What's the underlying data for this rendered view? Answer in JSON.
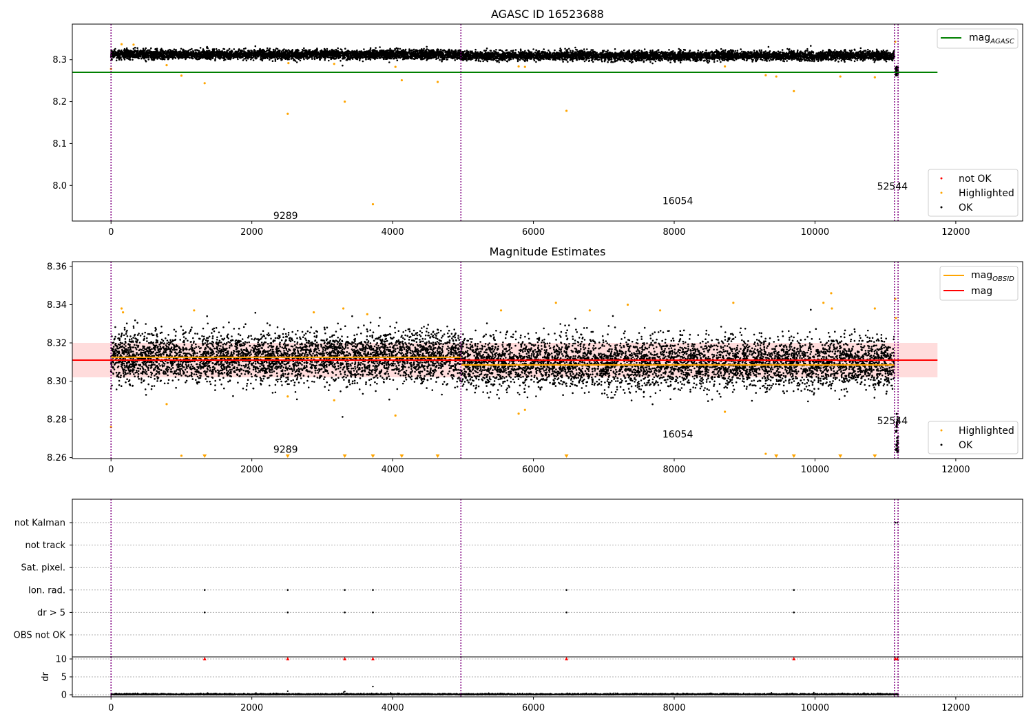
{
  "chart_data": [
    {
      "type": "scatter",
      "title": "AGASC ID 16523688",
      "xlim": [
        -550,
        12950
      ],
      "ylim": [
        7.915,
        8.385
      ],
      "xticks": [
        0,
        2000,
        4000,
        6000,
        8000,
        10000,
        12000
      ],
      "yticks": [
        8.0,
        8.1,
        8.2,
        8.3
      ],
      "ytick_labels": [
        "8.0",
        "8.1",
        "8.2",
        "8.3"
      ],
      "band": {
        "mean": 8.311,
        "std": 0.005
      },
      "series": [
        {
          "name": "not OK",
          "color": "#ff0000",
          "values": []
        },
        {
          "name": "Highlighted",
          "color": "#ffa500",
          "points": [
            [
              0,
              8.278
            ],
            [
              150,
              8.337
            ],
            [
              320,
              8.336
            ],
            [
              1000,
              8.262
            ],
            [
              1330,
              8.244
            ],
            [
              2510,
              8.171
            ],
            [
              3320,
              8.2
            ],
            [
              3720,
              7.955
            ],
            [
              4040,
              8.283
            ],
            [
              4130,
              8.251
            ],
            [
              4640,
              8.247
            ],
            [
              6470,
              8.178
            ],
            [
              9300,
              8.263
            ],
            [
              9450,
              8.26
            ],
            [
              9700,
              8.225
            ],
            [
              10360,
              8.26
            ],
            [
              10850,
              8.258
            ],
            [
              11140,
              8.343
            ],
            [
              790,
              8.287
            ],
            [
              3170,
              8.29
            ],
            [
              5790,
              8.284
            ],
            [
              5880,
              8.283
            ],
            [
              8720,
              8.284
            ],
            [
              2520,
              8.292
            ]
          ]
        },
        {
          "name": "OK",
          "color": "#000000",
          "trend_center": 8.311,
          "trend_spread": 0.007
        }
      ],
      "lines": [
        {
          "name": "mag_AGASC",
          "color": "#008000",
          "y": 8.27,
          "x_range": [
            -550,
            11740
          ]
        }
      ],
      "vlines": [
        0,
        4970,
        11130,
        11180
      ],
      "annotations": [
        {
          "text": "9289",
          "x": 2480,
          "y": 7.92
        },
        {
          "text": "16054",
          "x": 8050,
          "y": 7.955
        },
        {
          "text": "52544",
          "x": 11100,
          "y": 7.99
        }
      ],
      "legend_location": "lower right",
      "legend_top_right": "mag_AGASC"
    },
    {
      "type": "scatter",
      "title": "Magnitude Estimates",
      "xlim": [
        -550,
        12950
      ],
      "ylim": [
        8.2595,
        8.3625
      ],
      "xticks": [
        0,
        2000,
        4000,
        6000,
        8000,
        10000,
        12000
      ],
      "yticks": [
        8.26,
        8.28,
        8.3,
        8.32,
        8.34,
        8.36
      ],
      "ytick_labels": [
        "8.26",
        "8.28",
        "8.30",
        "8.32",
        "8.34",
        "8.36"
      ],
      "band": {
        "ymin": 8.302,
        "ymax": 8.32,
        "x_range": [
          -550,
          11740
        ],
        "color": "#ffc0c0"
      },
      "series": [
        {
          "name": "Highlighted",
          "color": "#ffa500",
          "points": [
            [
              0,
              8.276
            ],
            [
              150,
              8.338
            ],
            [
              170,
              8.336
            ],
            [
              1000,
              8.261
            ],
            [
              790,
              8.288
            ],
            [
              2510,
              8.292
            ],
            [
              3170,
              8.29
            ],
            [
              3300,
              8.338
            ],
            [
              4040,
              8.282
            ],
            [
              5790,
              8.283
            ],
            [
              5880,
              8.285
            ],
            [
              6320,
              8.341
            ],
            [
              6800,
              8.337
            ],
            [
              7340,
              8.34
            ],
            [
              7800,
              8.337
            ],
            [
              8720,
              8.284
            ],
            [
              8840,
              8.341
            ],
            [
              9300,
              8.262
            ],
            [
              10120,
              8.341
            ],
            [
              10230,
              8.346
            ],
            [
              10240,
              8.338
            ],
            [
              10850,
              8.338
            ],
            [
              11140,
              8.343
            ],
            [
              11150,
              8.333
            ],
            [
              5540,
              8.337
            ],
            [
              2880,
              8.336
            ],
            [
              3640,
              8.335
            ],
            [
              1180,
              8.337
            ]
          ]
        },
        {
          "name": "OK",
          "color": "#000000",
          "trend_center": 8.311,
          "trend_spread": 0.007
        }
      ],
      "floor_markers": [
        1330,
        2510,
        3320,
        3720,
        4130,
        4640,
        6470,
        9450,
        9700,
        10360,
        10850
      ],
      "lines": [
        {
          "name": "mag_OBSID",
          "color": "#ffa500",
          "segments": [
            [
              0,
              4970,
              8.3125
            ],
            [
              4970,
              11130,
              8.3085
            ]
          ]
        },
        {
          "name": "mag",
          "color": "#ff0000",
          "y": 8.311,
          "x_range": [
            -550,
            11740
          ]
        }
      ],
      "vlines": [
        0,
        4970,
        11130,
        11180
      ],
      "annotations": [
        {
          "text": "9289",
          "x": 2480,
          "y": 8.2625
        },
        {
          "text": "16054",
          "x": 8050,
          "y": 8.2705
        },
        {
          "text": "52544",
          "x": 11100,
          "y": 8.2775
        }
      ],
      "legend_top_right": [
        "mag_OBSID",
        "mag"
      ],
      "legend_bottom_right": [
        "Highlighted",
        "OK"
      ]
    },
    {
      "type": "scatter",
      "title": "",
      "xlim": [
        -550,
        12950
      ],
      "categories": [
        "not Kalman",
        "not track",
        "Sat. pixel.",
        "Ion. rad.",
        "dr > 5",
        "OBS not OK"
      ],
      "flags": {
        "not Kalman": [
          11140,
          11170
        ],
        "not track": [],
        "Sat. pixel.": [],
        "Ion. rad.": [
          1330,
          2510,
          3320,
          3720,
          6470,
          9700
        ],
        "dr > 5": [
          1330,
          2510,
          3320,
          3720,
          6470,
          9700
        ],
        "OBS not OK": []
      },
      "vlines": [
        0,
        4970,
        11130,
        11180
      ]
    },
    {
      "type": "scatter",
      "title": "",
      "xlim": [
        -550,
        12950
      ],
      "ylim": [
        -0.5,
        10.5
      ],
      "ylabel": "dr",
      "yticks": [
        0,
        5,
        10
      ],
      "ytick_labels": [
        "0",
        "5",
        "10"
      ],
      "xticks": [
        0,
        2000,
        4000,
        6000,
        8000,
        10000,
        12000
      ],
      "overflow_markers": [
        1330,
        2510,
        3320,
        3720,
        6470,
        9700,
        11140,
        11170
      ],
      "outliers": [
        [
          3720,
          2.3
        ],
        [
          2510,
          1.0
        ],
        [
          3320,
          0.9
        ]
      ],
      "vlines": [
        0,
        4970,
        11130,
        11180
      ]
    }
  ]
}
